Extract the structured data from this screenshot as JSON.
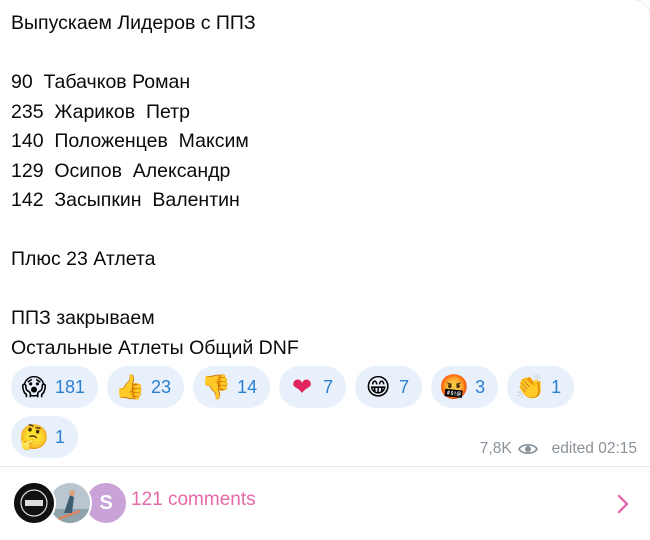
{
  "message": {
    "lines": [
      "Выпускаем Лидеров с ППЗ",
      "",
      "90  Табачков Роман",
      "235  Жариков  Петр",
      "140  Положенцев  Максим",
      "129  Осипов  Александр",
      "142  Засыпкин  Валентин",
      "",
      "Плюс 23 Атлета",
      "",
      "ППЗ закрываем",
      "Остальные Атлеты Общий DNF"
    ]
  },
  "reactions": [
    {
      "emoji": "😱",
      "icon": "screaming-face-icon",
      "count": "181"
    },
    {
      "emoji": "👍",
      "icon": "thumbs-up-icon",
      "count": "23"
    },
    {
      "emoji": "👎",
      "icon": "thumbs-down-icon",
      "count": "14"
    },
    {
      "emoji": "❤",
      "icon": "red-heart-icon",
      "count": "7"
    },
    {
      "emoji": "😁",
      "icon": "grinning-face-icon",
      "count": "7"
    },
    {
      "emoji": "🤬",
      "icon": "cursing-face-icon",
      "count": "3"
    },
    {
      "emoji": "👏",
      "icon": "clapping-hands-icon",
      "count": "1"
    },
    {
      "emoji": "🤔",
      "icon": "thinking-face-icon",
      "count": "1"
    }
  ],
  "meta": {
    "views": "7,8K",
    "views_icon": "eye-icon",
    "edited": "edited 02:15"
  },
  "comments": {
    "label": "121 comments",
    "avatar_letter": "S",
    "chevron_icon": "chevron-right-icon"
  },
  "colors": {
    "reaction_bg": "#e8f1fb",
    "reaction_count": "#2b7fd0",
    "comments_accent": "#e56aa9",
    "meta_gray": "#8a9299"
  }
}
